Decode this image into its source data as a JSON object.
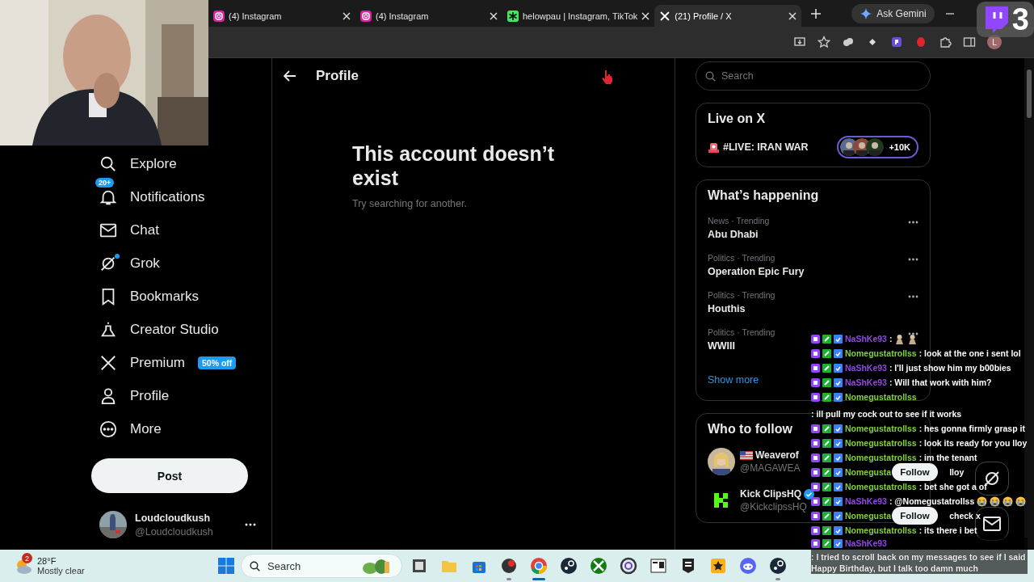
{
  "browser": {
    "tabs": [
      {
        "title": "(4) Instagram",
        "kind": "instagram",
        "selected": false
      },
      {
        "title": "(4) Instagram",
        "kind": "instagram",
        "selected": false
      },
      {
        "title": "helowpau | Instagram, TikTok",
        "kind": "linktree",
        "selected": false
      },
      {
        "title": "(21) Profile / X",
        "kind": "x",
        "selected": true
      }
    ],
    "gemini_button": "Ask Gemini",
    "profile_initial": "L"
  },
  "stream_overlay": {
    "counter": "3"
  },
  "nav": {
    "items": [
      {
        "label": "Explore",
        "dot": false
      },
      {
        "label": "Notifications",
        "badge": "20+",
        "dot": false
      },
      {
        "label": "Chat",
        "dot": false
      },
      {
        "label": "Grok",
        "dot": true
      },
      {
        "label": "Bookmarks",
        "dot": false
      },
      {
        "label": "Creator Studio",
        "dot": false
      },
      {
        "label": "Premium",
        "badge": "50% off",
        "dot": false
      },
      {
        "label": "Profile",
        "dot": false
      },
      {
        "label": "More",
        "dot": false
      }
    ],
    "post_button": "Post",
    "account": {
      "name": "Loudcloudkush",
      "handle": "@Loudcloudkush"
    }
  },
  "main": {
    "header": "Profile",
    "empty_title": "This account doesn’t exist",
    "empty_subtitle": "Try searching for another."
  },
  "sidebar": {
    "search": {
      "placeholder": "Search"
    },
    "live": {
      "title": "Live on X",
      "event": "#LIVE: IRAN WAR",
      "viewers": "+10K"
    },
    "trends": {
      "title": "What’s happening",
      "items": [
        {
          "category": "News · Trending",
          "title": "Abu Dhabi"
        },
        {
          "category": "Politics · Trending",
          "title": "Operation Epic Fury"
        },
        {
          "category": "Politics · Trending",
          "title": "Houthis"
        },
        {
          "category": "Politics · Trending",
          "title": "WWIII"
        }
      ],
      "show_more": "Show more"
    },
    "who_to_follow": {
      "title": "Who to follow",
      "accounts": [
        {
          "name": "Weaverof",
          "handle": "@MAGAWEA",
          "flag": true,
          "verified": false,
          "button": "Follow"
        },
        {
          "name": "Kick ClipsHQ",
          "handle": "@KickclipssHQ",
          "kind": "kick",
          "flag": false,
          "verified": true,
          "button": "Follow"
        }
      ]
    }
  },
  "chat": {
    "messages": [
      {
        "user": "NaShKe93",
        "color": "#9147e6",
        "text": ":",
        "kind": "figures",
        "faded": false
      },
      {
        "user": "Nomegustatrollss",
        "color": "#84d13c",
        "text": ": look at the one i sent lol",
        "kind": "plain",
        "faded": false
      },
      {
        "user": "NaShKe93",
        "color": "#9147e6",
        "text": ": I'll just show him my b00bies",
        "kind": "plain",
        "faded": false
      },
      {
        "user": "NaShKe93",
        "color": "#9147e6",
        "text": ": Will that work with him?",
        "kind": "plain",
        "faded": false
      },
      {
        "user": "Nomegustatrollss",
        "color": "#84d13c",
        "text": ": ill pull my cock out to see if it works",
        "kind": "plain",
        "faded": false
      },
      {
        "user": "Nomegustatrollss",
        "color": "#84d13c",
        "text": ": hes gonna firmly grasp it",
        "kind": "plain",
        "faded": false
      },
      {
        "user": "Nomegustatrollss",
        "color": "#84d13c",
        "text": ": look its ready for you lloy",
        "kind": "plain",
        "faded": false
      },
      {
        "user": "Nomegustatrollss",
        "color": "#84d13c",
        "text": ": im the tenant",
        "kind": "plain",
        "faded": false
      },
      {
        "user": "Nomegusta",
        "color": "#84d13c",
        "text": "lloy",
        "kind": "covered",
        "faded": false
      },
      {
        "user": "Nomegustatrollss",
        "color": "#84d13c",
        "text": ": bet she got a of",
        "kind": "plain",
        "faded": false
      },
      {
        "user": "NaShKe93",
        "color": "#9147e6",
        "text": ": @Nomegustatrollss",
        "kind": "crying",
        "faded": false
      },
      {
        "user": "Nomegusta",
        "color": "#84d13c",
        "text": "check x",
        "kind": "covered",
        "faded": false
      },
      {
        "user": "Nomegustatrollss",
        "color": "#84d13c",
        "text": ": its there i bet",
        "kind": "plain",
        "faded": false
      },
      {
        "user": "NaShKe93",
        "color": "#9147e6",
        "text": ": I tried to scroll back on my messages to see if I said Happy Birthday, but I talk too damn much",
        "kind": "plain",
        "faded": true
      }
    ]
  },
  "taskbar": {
    "weather": {
      "alerts": "2",
      "temperature": "28°F",
      "condition": "Mostly clear"
    },
    "search": {
      "placeholder": "Search"
    },
    "apps": [
      {
        "kind": "taskview",
        "running": false,
        "selected": false
      },
      {
        "kind": "files",
        "running": false,
        "selected": false
      },
      {
        "kind": "store",
        "running": false,
        "selected": false
      },
      {
        "kind": "recorder",
        "running": true,
        "selected": false
      },
      {
        "kind": "chrome",
        "running": true,
        "selected": true
      },
      {
        "kind": "steam",
        "running": false,
        "selected": false
      },
      {
        "kind": "xbox",
        "running": false,
        "selected": false
      },
      {
        "kind": "ring",
        "running": false,
        "selected": false
      },
      {
        "kind": "archive",
        "running": false,
        "selected": false
      },
      {
        "kind": "epic",
        "running": false,
        "selected": false
      },
      {
        "kind": "rockstar",
        "running": false,
        "selected": false
      },
      {
        "kind": "discord",
        "running": false,
        "selected": false
      },
      {
        "kind": "steam",
        "running": true,
        "selected": false
      }
    ]
  }
}
